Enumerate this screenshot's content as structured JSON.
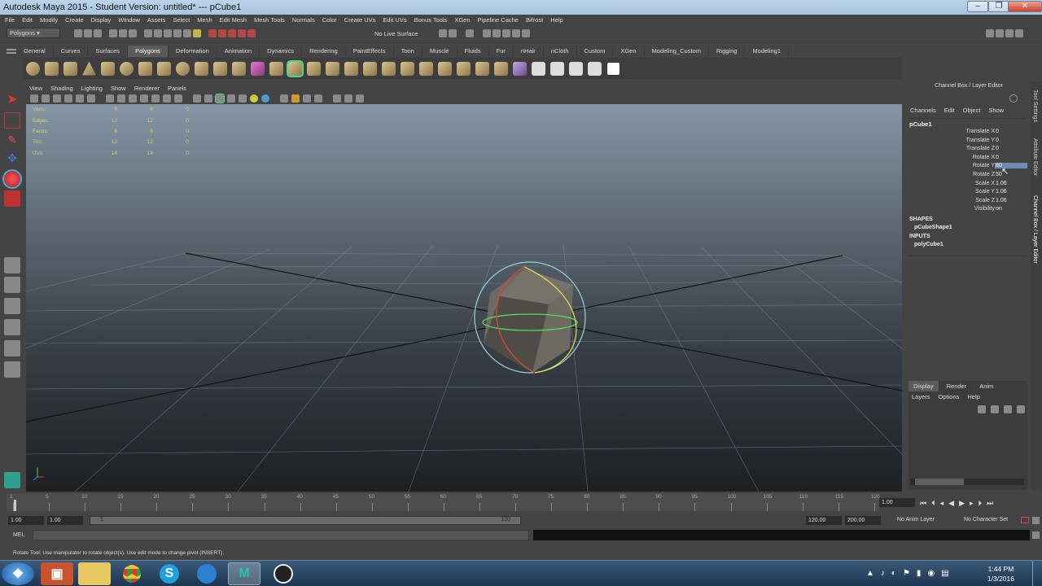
{
  "window": {
    "title": "Autodesk Maya 2015 - Student Version: untitled*   ---   pCube1"
  },
  "menubar": [
    "File",
    "Edit",
    "Modify",
    "Create",
    "Display",
    "Window",
    "Assets",
    "Select",
    "Mesh",
    "Edit Mesh",
    "Mesh Tools",
    "Normals",
    "Color",
    "Create UVs",
    "Edit UVs",
    "Bonus Tools",
    "XGen",
    "Pipeline Cache",
    "Bifrost",
    "Help"
  ],
  "statusline": {
    "mode": "Polygons",
    "live_surface": "No Live Surface"
  },
  "shelf": {
    "tabs": [
      "General",
      "Curves",
      "Surfaces",
      "Polygons",
      "Deformation",
      "Animation",
      "Dynamics",
      "Rendering",
      "PaintEffects",
      "Toon",
      "Muscle",
      "Fluids",
      "Fur",
      "nHair",
      "nCloth",
      "Custom",
      "XGen",
      "Modeling_Custom",
      "Rigging",
      "Modeling1"
    ],
    "active": "Polygons"
  },
  "viewport": {
    "menu": [
      "View",
      "Shading",
      "Lighting",
      "Show",
      "Renderer",
      "Panels"
    ],
    "hud": [
      {
        "label": "Verts:",
        "a": "8",
        "b": "8",
        "c": "0"
      },
      {
        "label": "Edges:",
        "a": "12",
        "b": "12",
        "c": "0"
      },
      {
        "label": "Faces:",
        "a": "6",
        "b": "6",
        "c": "0"
      },
      {
        "label": "Tris:",
        "a": "12",
        "b": "12",
        "c": "0"
      },
      {
        "label": "UVs:",
        "a": "14",
        "b": "14",
        "c": "0"
      }
    ]
  },
  "channelbox": {
    "panel_title": "Channel Box / Layer Editor",
    "menu": [
      "Channels",
      "Edit",
      "Object",
      "Show"
    ],
    "object": "pCube1",
    "channels": [
      {
        "label": "Translate X",
        "value": "0"
      },
      {
        "label": "Translate Y",
        "value": "0"
      },
      {
        "label": "Translate Z",
        "value": "0"
      },
      {
        "label": "Rotate X",
        "value": "0"
      },
      {
        "label": "Rotate Y",
        "value": "80"
      },
      {
        "label": "Rotate Z",
        "value": "50"
      },
      {
        "label": "Scale X",
        "value": "1.06"
      },
      {
        "label": "Scale Y",
        "value": "1.06"
      },
      {
        "label": "Scale Z",
        "value": "1.06"
      },
      {
        "label": "Visibility",
        "value": "on"
      }
    ],
    "shapes_header": "SHAPES",
    "shape": "pCubeShape1",
    "inputs_header": "INPUTS",
    "input": "polyCube1"
  },
  "layers": {
    "tabs": [
      "Display",
      "Render",
      "Anim"
    ],
    "menu": [
      "Layers",
      "Options",
      "Help"
    ]
  },
  "sidetabs": [
    "Tool Settings",
    "Attribute Editor",
    "Channel Box / Layer Editor"
  ],
  "timeslider": {
    "ticks": [
      "1",
      "5",
      "10",
      "15",
      "20",
      "25",
      "30",
      "35",
      "40",
      "45",
      "50",
      "55",
      "60",
      "65",
      "70",
      "75",
      "80",
      "85",
      "90",
      "95",
      "100",
      "105",
      "110",
      "115",
      "120"
    ],
    "current": "1.00"
  },
  "range": {
    "start": "1.00",
    "inner_start": "1.00",
    "range_start_label": "1",
    "range_end_label": "120",
    "end": "120.00",
    "outer_end": "200.00",
    "anim_layer": "No Anim Layer",
    "char_set": "No Character Set"
  },
  "mel": {
    "label": "MEL"
  },
  "helpline": "Rotate Tool: Use manipulator to rotate object(s). Use edit mode to change pivot (INSERT).",
  "taskbar": {
    "time": "1:44 PM",
    "date": "1/3/2016"
  }
}
